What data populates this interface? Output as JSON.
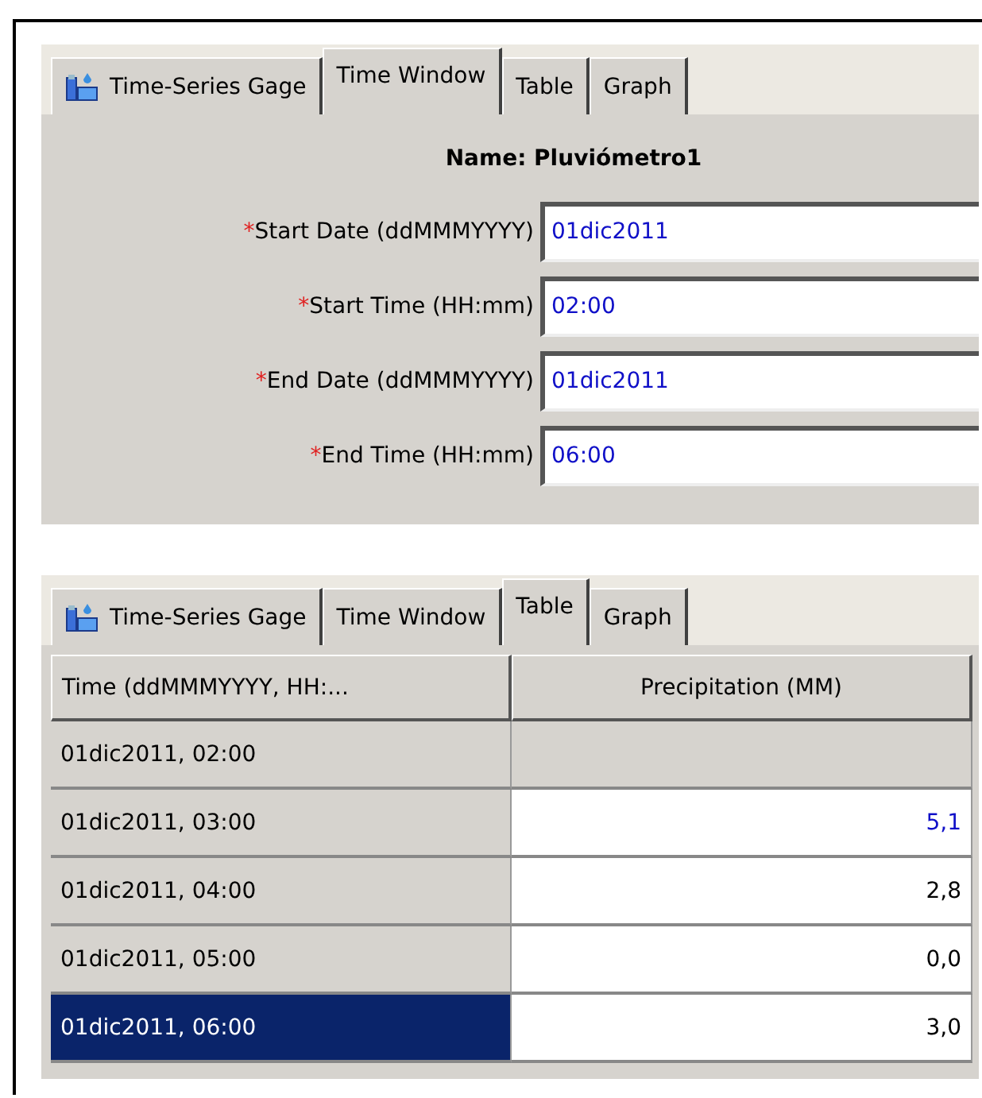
{
  "panels": [
    {
      "tabs": [
        {
          "label": "Time-Series Gage",
          "icon": true,
          "selected": false
        },
        {
          "label": "Time Window",
          "selected": true
        },
        {
          "label": "Table",
          "selected": false
        },
        {
          "label": "Graph",
          "selected": false
        }
      ],
      "kind": "form",
      "name": "Name: Pluviómetro1",
      "fields": [
        {
          "label": "Start Date (ddMMMYYYY)",
          "required_mark": "*",
          "value": "01dic2011"
        },
        {
          "label": "Start Time (HH:mm)",
          "required_mark": "*",
          "value": "02:00"
        },
        {
          "label": "End Date (ddMMMYYYY)",
          "required_mark": "*",
          "value": "01dic2011"
        },
        {
          "label": "End Time (HH:mm)",
          "required_mark": "*",
          "value": "06:00"
        }
      ]
    },
    {
      "tabs": [
        {
          "label": "Time-Series Gage",
          "icon": true,
          "selected": false
        },
        {
          "label": "Time Window",
          "selected": false
        },
        {
          "label": "Table",
          "selected": true
        },
        {
          "label": "Graph",
          "selected": false
        }
      ],
      "kind": "table",
      "columns": [
        "Time (ddMMMYYYY, HH:...",
        "Precipitation (MM)"
      ],
      "rows": [
        {
          "time": "01dic2011, 02:00",
          "editable": false,
          "selected": false
        },
        {
          "time": "01dic2011, 03:00",
          "value": "5,1",
          "editable": true,
          "modified": true,
          "selected": false
        },
        {
          "time": "01dic2011, 04:00",
          "value": "2,8",
          "editable": true,
          "modified": false,
          "selected": false
        },
        {
          "time": "01dic2011, 05:00",
          "value": "0,0",
          "editable": true,
          "modified": false,
          "selected": false
        },
        {
          "time": "01dic2011, 06:00",
          "value": "3,0",
          "editable": true,
          "modified": false,
          "selected": true
        }
      ]
    }
  ]
}
